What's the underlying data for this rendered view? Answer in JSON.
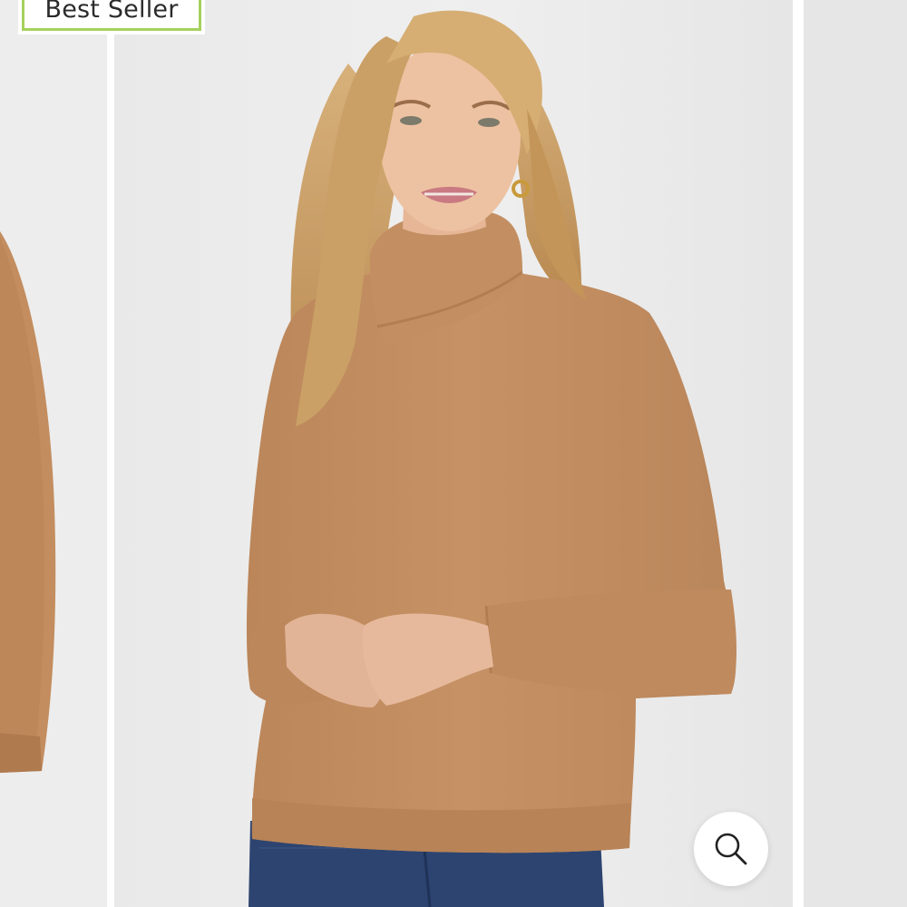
{
  "product_gallery": {
    "badge": {
      "label": "Best Seller"
    },
    "slides": [
      {
        "image": "sweater-flat-lay-photo",
        "state": "previous"
      },
      {
        "image": "model-wearing-camel-fleece-turtleneck-photo",
        "state": "current"
      },
      {
        "image": "sweater-alternate-view-photo",
        "state": "next"
      }
    ],
    "zoom_button": {
      "icon": "magnifier-icon"
    },
    "colors": {
      "sweater": "#c08c60",
      "background": "#ececec",
      "badge_border": "#a6d15e",
      "jeans": "#2d4470",
      "hair": "#c79f64"
    }
  }
}
